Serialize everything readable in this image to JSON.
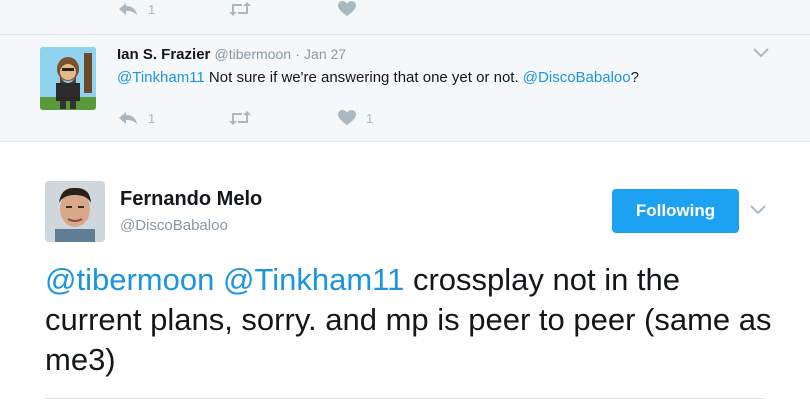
{
  "previous_tweet": {
    "actions": {
      "reply_count": "1",
      "retweet_count": "",
      "like_count": ""
    }
  },
  "reply_tweet": {
    "author_name": "Ian S. Frazier",
    "author_handle": "@tibermoon",
    "separator": "·",
    "date": "Jan 27",
    "mention": "@Tinkham11",
    "text_mid": " Not sure if we're answering that one yet or not. ",
    "mention2": "@DiscoBabaloo",
    "text_end": "?",
    "actions": {
      "reply_count": "1",
      "retweet_count": "",
      "like_count": "1"
    }
  },
  "main_tweet": {
    "author_name": "Fernando Melo",
    "author_handle": "@DiscoBabaloo",
    "follow_label": "Following",
    "mention1": "@tibermoon",
    "mention2": "@Tinkham11",
    "text": " crossplay not in the current plans, sorry.  and mp is peer to peer (same as me3)"
  },
  "colors": {
    "link": "#1b95e0",
    "follow_button": "#1da1f2",
    "muted": "#8899a6",
    "action_icon": "#aab8c2",
    "reply_background": "#f5f8fa"
  },
  "icons": [
    "reply-icon",
    "retweet-icon",
    "heart-icon",
    "chevron-down-icon",
    "avatar-icon"
  ]
}
